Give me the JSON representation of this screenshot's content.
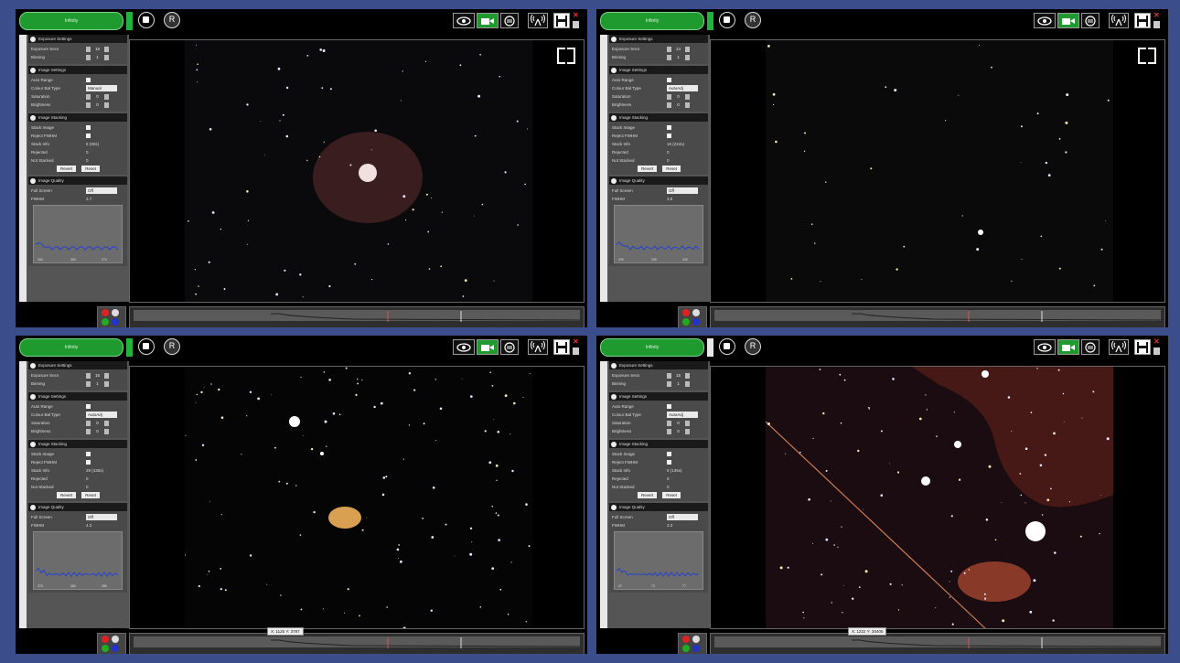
{
  "panels": [
    {
      "infinity_label": "Infinity",
      "r_label": "R",
      "exposure_title": "Exposure Settings",
      "exposure_label": "Exposure Secs",
      "exposure_value": "15",
      "binning_label": "Binning",
      "binning_value": "1",
      "image_title": "Image Settings",
      "auto_range_label": "Auto Range",
      "colour_bal_label": "Colour Bal Type",
      "colour_bal_value": "Manual",
      "saturation_label": "Saturation",
      "saturation_value": "0",
      "brightness_label": "Brightness",
      "brightness_value": "0",
      "stacking_title": "Image Stacking",
      "stack_image_label": "Stack Image",
      "reject_fwhm_label": "Reject FWHM",
      "stack_info_label": "Stack Info",
      "stack_info_value": "6 (90s)",
      "rejected_label": "Rejected",
      "rejected_value": "0",
      "not_stacked_label": "Not Stacked",
      "not_stacked_value": "0",
      "revert_label": "Revert",
      "reset_label": "Reset",
      "quality_title": "Image Quality",
      "full_screen_label": "Full Screen",
      "full_screen_value": "Off",
      "fwhm_label": "FWHM",
      "fwhm_value": "3.7",
      "graph_ticks": [
        "264",
        "269",
        "274"
      ],
      "coord_text": ""
    },
    {
      "infinity_label": "Infinity",
      "r_label": "R",
      "exposure_title": "Exposure Settings",
      "exposure_label": "Exposure Secs",
      "exposure_value": "14",
      "binning_label": "Binning",
      "binning_value": "1",
      "image_title": "Image Settings",
      "auto_range_label": "Auto Range",
      "colour_bal_label": "Colour Bal Type",
      "colour_bal_value": "AutoAdj",
      "saturation_label": "Saturation",
      "saturation_value": "0",
      "brightness_label": "Brightness",
      "brightness_value": "0",
      "stacking_title": "Image Stacking",
      "stack_image_label": "Stack Image",
      "reject_fwhm_label": "Reject FWHM",
      "stack_info_label": "Stack Info",
      "stack_info_value": "16 (224s)",
      "rejected_label": "Rejected",
      "rejected_value": "0",
      "not_stacked_label": "Not Stacked",
      "not_stacked_value": "0",
      "revert_label": "Revert",
      "reset_label": "Reset",
      "quality_title": "Image Quality",
      "full_screen_label": "Full Screen",
      "full_screen_value": "Off",
      "fwhm_label": "FWHM",
      "fwhm_value": "3.8",
      "graph_ticks": [
        "290",
        "295",
        "300"
      ],
      "coord_text": ""
    },
    {
      "infinity_label": "Infinity",
      "r_label": "R",
      "exposure_title": "Exposure Settings",
      "exposure_label": "Exposure Secs",
      "exposure_value": "15",
      "binning_label": "Binning",
      "binning_value": "1",
      "image_title": "Image Settings",
      "auto_range_label": "Auto Range",
      "colour_bal_label": "Colour Bal Type",
      "colour_bal_value": "AutoAdj",
      "saturation_label": "Saturation",
      "saturation_value": "0",
      "brightness_label": "Brightness",
      "brightness_value": "0",
      "stacking_title": "Image Stacking",
      "stack_image_label": "Stack Image",
      "reject_fwhm_label": "Reject FWHM",
      "stack_info_label": "Stack Info",
      "stack_info_value": "29 (435s)",
      "rejected_label": "Rejected",
      "rejected_value": "0",
      "not_stacked_label": "Not Stacked",
      "not_stacked_value": "0",
      "revert_label": "Revert",
      "reset_label": "Reset",
      "quality_title": "Image Quality",
      "full_screen_label": "Full Screen",
      "full_screen_value": "Off",
      "fwhm_label": "FWHM",
      "fwhm_value": "4.3",
      "graph_ticks": [
        "375",
        "380",
        "385"
      ],
      "coord_text": "X: 1125 Y: 3787"
    },
    {
      "infinity_label": "Infinity",
      "r_label": "R",
      "exposure_title": "Exposure Settings",
      "exposure_label": "Exposure Secs",
      "exposure_value": "15",
      "binning_label": "Binning",
      "binning_value": "1",
      "image_title": "Image Settings",
      "auto_range_label": "Auto Range",
      "colour_bal_label": "Colour Bal Type",
      "colour_bal_value": "AutoAdj",
      "saturation_label": "Saturation",
      "saturation_value": "0",
      "brightness_label": "Brightness",
      "brightness_value": "0",
      "stacking_title": "Image Stacking",
      "stack_image_label": "Stack Image",
      "reject_fwhm_label": "Reject FWHM",
      "stack_info_label": "Stack Info",
      "stack_info_value": "9 (135s)",
      "rejected_label": "Rejected",
      "rejected_value": "0",
      "not_stacked_label": "Not Stacked",
      "not_stacked_value": "0",
      "revert_label": "Revert",
      "reset_label": "Reset",
      "quality_title": "Image Quality",
      "full_screen_label": "Full Screen",
      "full_screen_value": "Off",
      "fwhm_label": "FWHM",
      "fwhm_value": "3.3",
      "graph_ticks": [
        "67",
        "72",
        "77"
      ],
      "coord_text": "X: 1222 Y: 30405"
    }
  ],
  "icons": {
    "eye": "eye-icon",
    "camera": "video-camera-icon",
    "switch": "switch-icon",
    "broadcast": "broadcast-icon",
    "save": "save-icon",
    "close": "close-icon",
    "trash": "trash-icon"
  },
  "colors": {
    "accent_green": "#1f9a2e",
    "background": "#3b4d8a"
  }
}
